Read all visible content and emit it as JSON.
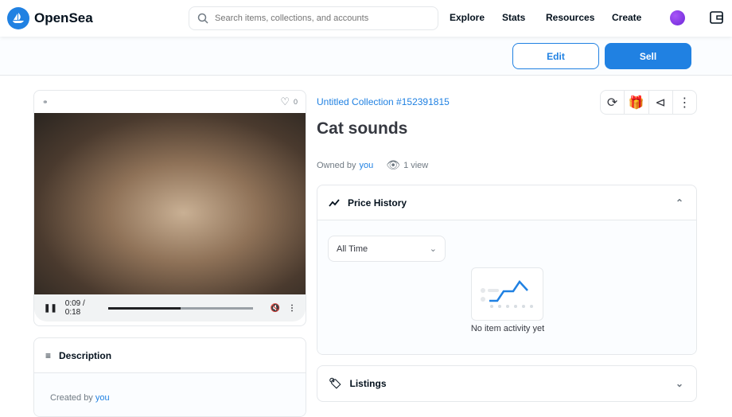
{
  "nav": {
    "brand": "OpenSea",
    "search_placeholder": "Search items, collections, and accounts",
    "links": [
      "Explore",
      "Stats",
      "Resources",
      "Create"
    ]
  },
  "toolbar": {
    "edit": "Edit",
    "sell": "Sell"
  },
  "media": {
    "likes": "0",
    "time": "0:09 / 0:18",
    "progress": 0.5
  },
  "description": {
    "title": "Description",
    "created_by": "Created by",
    "creator": "you"
  },
  "item": {
    "collection": "Untitled Collection #152391815",
    "title": "Cat sounds",
    "owned_by": "Owned by",
    "owner": "you",
    "views": "1 view"
  },
  "price_history": {
    "title": "Price History",
    "range": "All Time",
    "empty": "No item activity yet"
  },
  "listings": {
    "title": "Listings"
  },
  "colors": {
    "accent": "#2081e2"
  }
}
